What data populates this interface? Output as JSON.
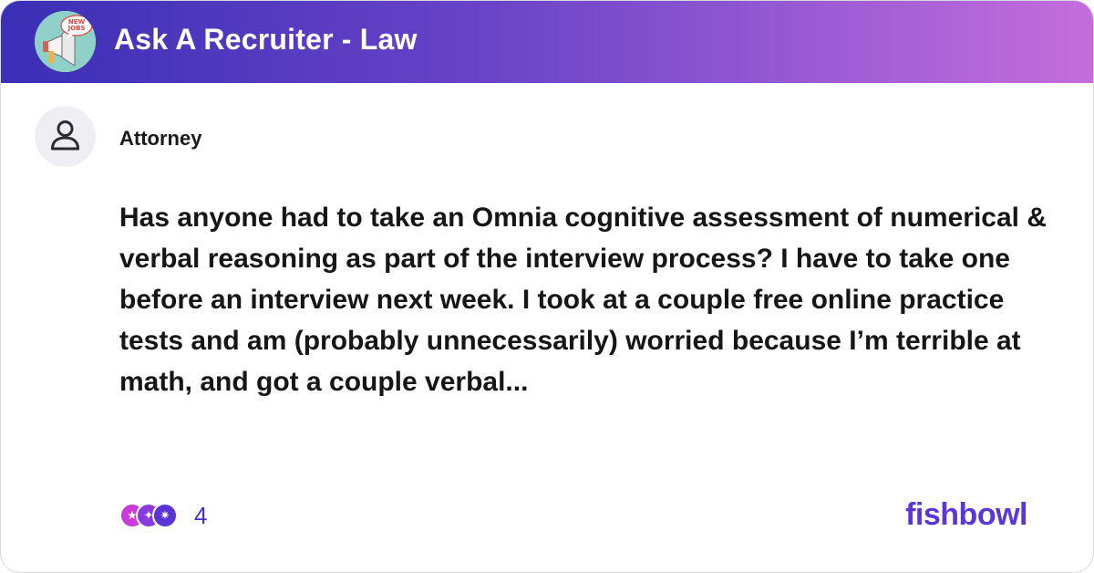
{
  "header": {
    "bowl_name": "Ask A Recruiter - Law",
    "bowl_logo_badge": "NEW JOBS",
    "bowl_logo_icon": "megaphone-icon"
  },
  "post": {
    "author": "Attorney",
    "author_icon": "user-icon",
    "text": "Has anyone had to take an Omnia cognitive assessment of numerical & verbal reasoning as part of the interview process? I have to take one before an interview next week. I took at a couple free online practice tests and am (probably unnecessarily) worried because I’m terrible at math, and got a couple verbal..."
  },
  "footer": {
    "reaction_count": "4",
    "brand": "fishbowl"
  },
  "colors": {
    "header_gradient_start": "#3a2fb6",
    "header_gradient_end": "#c46ddc",
    "accent": "#5a36d8"
  }
}
